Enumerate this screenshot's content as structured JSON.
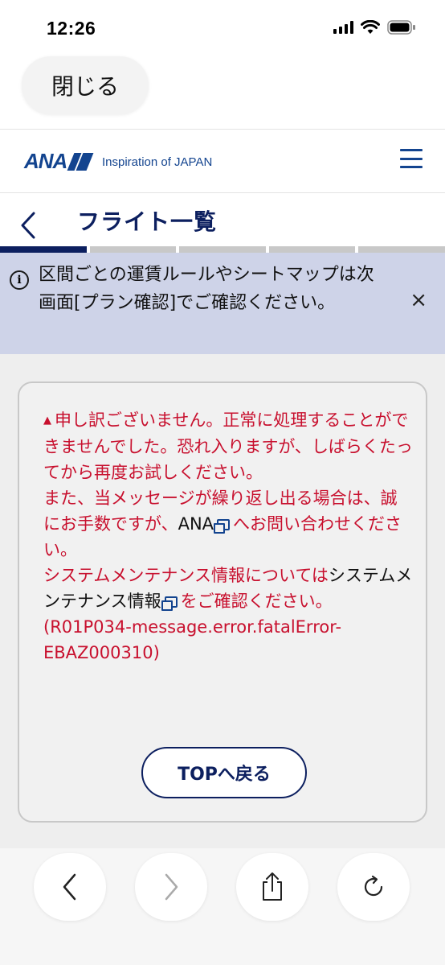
{
  "status_bar": {
    "time": "12:26"
  },
  "browser": {
    "close_label": "閉じる"
  },
  "header": {
    "logo_text": "ANA",
    "tagline": "Inspiration of JAPAN"
  },
  "page": {
    "title": "フライト一覧",
    "progress_steps": 5,
    "active_step": 1
  },
  "info_banner": {
    "message": "区間ごとの運賃ルールやシートマップは次画面[プラン確認]でご確認ください。",
    "close_symbol": "×"
  },
  "error": {
    "line1": "申し訳ございません。正常に処理することができませんでした。恐れ入りますが、しばらくたってから再度お試しください。",
    "line2_before": "また、当メッセージが繰り返し出る場合は、誠にお手数ですが、",
    "line2_link": "ANA",
    "line2_after": "へお問い合わせください。",
    "line3_before": "システムメンテナンス情報については",
    "line3_link": "システムメンテナンス情報",
    "line3_after": "をご確認ください。",
    "code": "(R01P034-message.error.fatalError-EBAZ000310)",
    "button_label": "TOPへ戻る"
  },
  "colors": {
    "brand_navy": "#0c1f5f",
    "ana_blue": "#13448f",
    "error_red": "#c8102e",
    "banner_bg": "#ced3e8"
  }
}
